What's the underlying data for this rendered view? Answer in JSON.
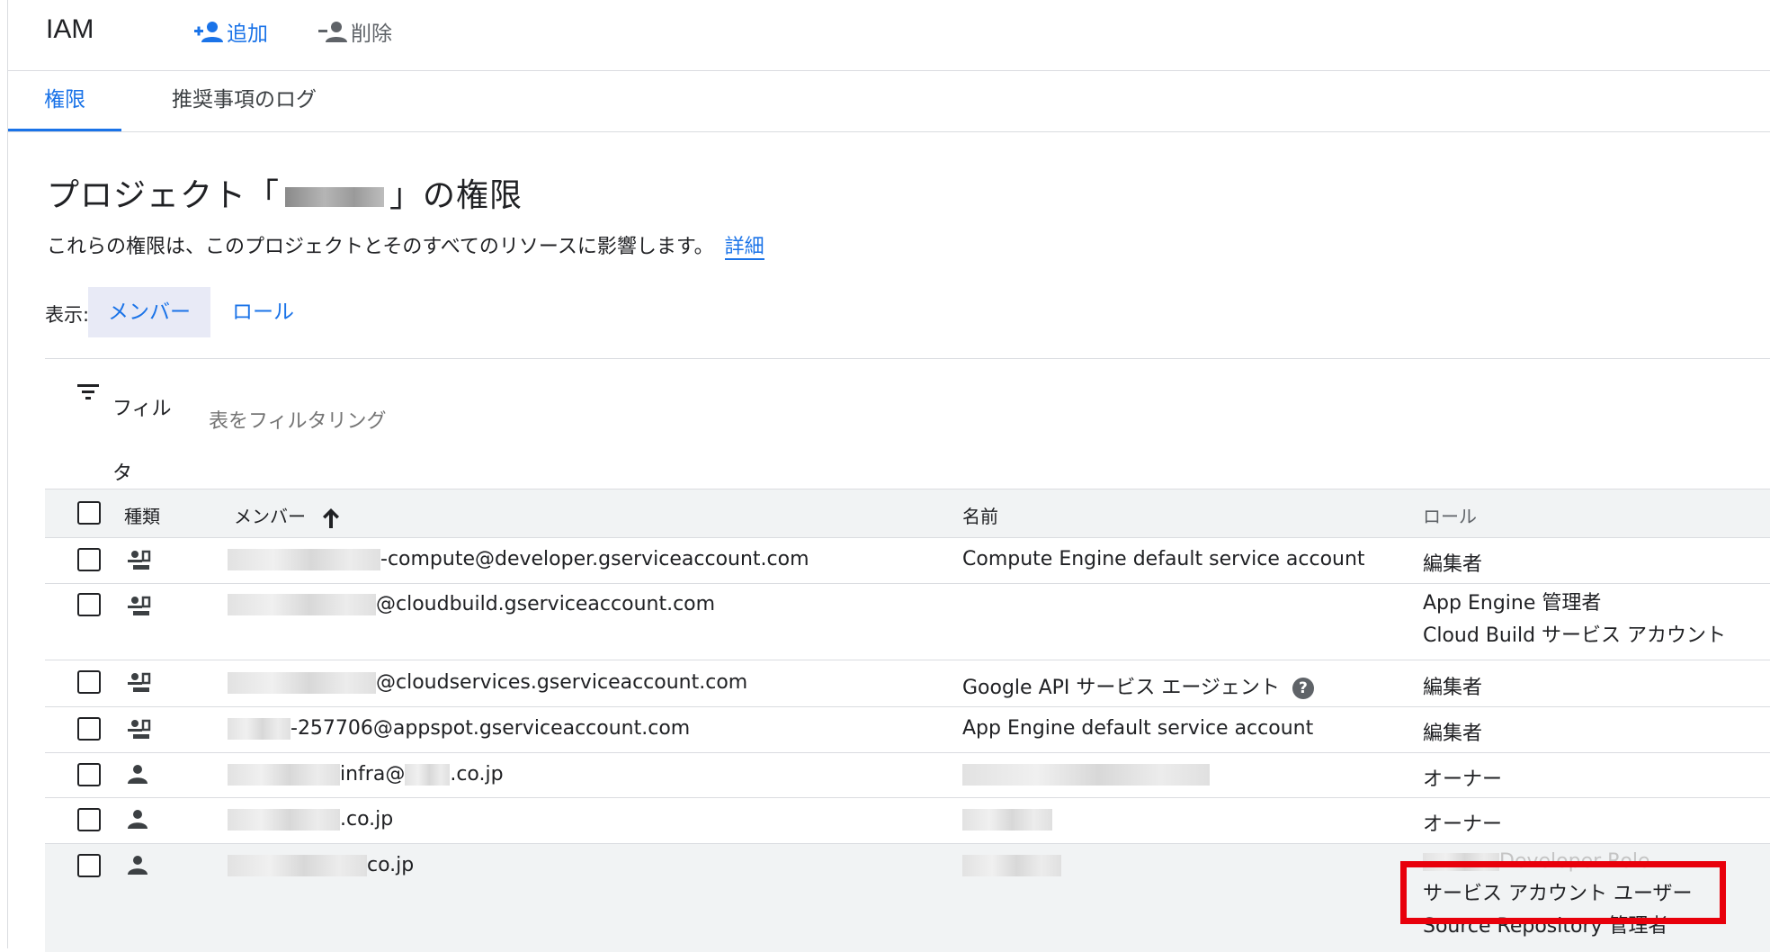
{
  "header": {
    "title": "IAM",
    "add_label": "追加",
    "remove_label": "削除"
  },
  "tabs": [
    {
      "label": "権限",
      "active": true
    },
    {
      "label": "推奨事項のログ",
      "active": false
    }
  ],
  "page": {
    "title_prefix": "プロジェクト「",
    "title_suffix": "」の権限",
    "description": "これらの権限は、このプロジェクトとそのすべてのリソースに影響します。",
    "details_link": "詳細"
  },
  "view": {
    "label": "表示:",
    "members": "メンバー",
    "roles": "ロール"
  },
  "filter": {
    "label": "フィルタ",
    "placeholder": "表をフィルタリング"
  },
  "table": {
    "headers": {
      "type": "種類",
      "member": "メンバー",
      "name": "名前",
      "role": "ロール"
    },
    "rows": [
      {
        "kind": "service-account",
        "member": "-compute@developer.gserviceaccount.com",
        "name": "Compute Engine default service account",
        "roles": [
          "編集者"
        ]
      },
      {
        "kind": "service-account",
        "member": "@cloudbuild.gserviceaccount.com",
        "name": "",
        "roles": [
          "App Engine 管理者",
          "Cloud Build サービス アカウント"
        ]
      },
      {
        "kind": "service-account",
        "member": "@cloudservices.gserviceaccount.com",
        "name": "Google API サービス エージェント",
        "roles": [
          "編集者"
        ]
      },
      {
        "kind": "service-account",
        "member": "-257706@appspot.gserviceaccount.com",
        "name": "App Engine default service account",
        "roles": [
          "編集者"
        ]
      },
      {
        "kind": "user",
        "member_mid": "infra@",
        "member_end": ".co.jp",
        "name": "",
        "roles": [
          "オーナー"
        ]
      },
      {
        "kind": "user",
        "member": ".co.jp",
        "name": "",
        "roles": [
          "オーナー"
        ]
      },
      {
        "kind": "user",
        "member": "co.jp",
        "name": "",
        "roles": [
          "Developer Role",
          "サービス アカウント ユーザー",
          "Source Repository 管理者"
        ]
      }
    ]
  },
  "colors": {
    "accent": "#1a73e8",
    "highlight": "#e8000b"
  }
}
